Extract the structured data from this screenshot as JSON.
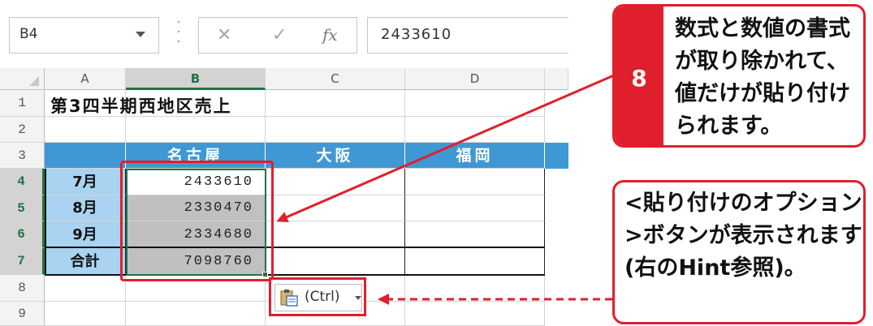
{
  "formula_bar": {
    "name_box": "B4",
    "cancel_icon": "✕",
    "enter_icon": "✓",
    "fx_label": "fx",
    "value": "2433610"
  },
  "columns": [
    "A",
    "B",
    "C",
    "D"
  ],
  "rows": [
    "1",
    "2",
    "3",
    "4",
    "5",
    "6",
    "7",
    "8",
    "9"
  ],
  "title": "第3四半期西地区売上",
  "headers": [
    "名古屋",
    "大阪",
    "福岡"
  ],
  "data_rows": [
    {
      "month": "7月",
      "value": "2433610"
    },
    {
      "month": "8月",
      "value": "2330470"
    },
    {
      "month": "9月",
      "value": "2334680"
    },
    {
      "month": "合計",
      "value": "7098760"
    }
  ],
  "paste_options": {
    "label": "(Ctrl)",
    "icon": "clipboard-icon"
  },
  "callout_step": {
    "number": "8",
    "text": "数式と数値の書式が取り除かれて、値だけが貼り付けられます。"
  },
  "callout_note": {
    "text": "<貼り付けのオプション>ボタンが表示されます(右のHint参照)。"
  },
  "colors": {
    "accent_red": "#e01f2c",
    "header_blue": "#3f98d3",
    "month_blue": "#a9d3f0",
    "selection_gray": "#c0c0c0",
    "selection_border": "#217346"
  }
}
